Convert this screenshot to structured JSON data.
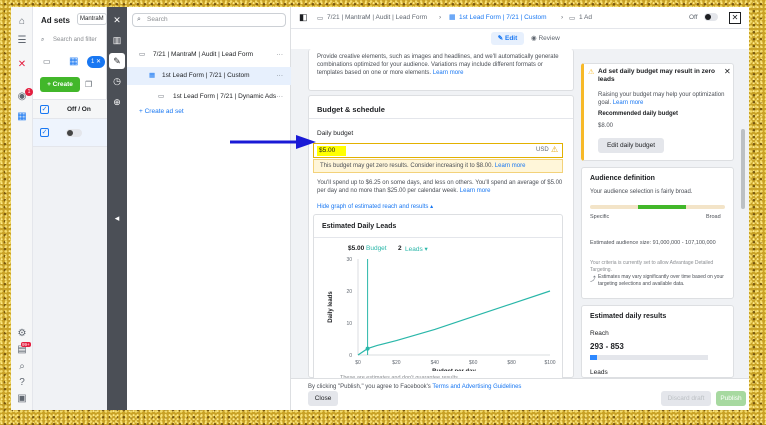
{
  "rail": {
    "notif_badge": "1",
    "alert_badge": "99+"
  },
  "adsets": {
    "title": "Ad sets",
    "tag": "MantraM",
    "search_placeholder": "Search and filter",
    "selected_count": "1",
    "create_label": "+ Create",
    "col_off_on": "Off / On"
  },
  "tree": {
    "search_placeholder": "Search",
    "items": [
      {
        "label": "7/21 | MantraM | Audit | Lead Form"
      },
      {
        "label": "1st Lead Form | 7/21 | Custom"
      },
      {
        "label": "1st Lead Form | 7/21 | Dynamic Ads"
      }
    ],
    "create_ad_set": "+ Create ad set"
  },
  "topbar": {
    "crumbs": [
      "7/21 | MantraM | Audit | Lead Form",
      "1st Lead Form | 7/21 | Custom",
      "1 Ad"
    ],
    "off_label": "Off",
    "edit_label": "Edit",
    "review_label": "Review"
  },
  "creative": {
    "text": "Provide creative elements, such as images and headlines, and we'll automatically generate combinations optimized for your audience. Variations may include different formats or templates based on one or more elements.",
    "learn_more": "Learn more"
  },
  "budget": {
    "section_title": "Budget & schedule",
    "daily_label": "Daily budget",
    "value": "$5.00",
    "currency": "USD",
    "warning": "This budget may get zero results. Consider increasing it to $8.00.",
    "warning_link": "Learn more",
    "spend_note": "You'll spend up to $6.25 on some days, and less on others. You'll spend an average of $5.00 per day and no more than $25.00 per calendar week.",
    "spend_link": "Learn more",
    "hide_graph": "Hide graph of estimated reach and results"
  },
  "chart_card": {
    "title": "Estimated Daily Leads",
    "budget_value": "$5.00",
    "budget_word": "Budget",
    "leads_value": "2",
    "leads_word": "Leads",
    "footnote": "These are estimates and don't guarantee results."
  },
  "chart_data": {
    "type": "line",
    "title": "",
    "xlabel": "Budget per day",
    "ylabel": "Daily leads",
    "x_ticks": [
      "$0",
      "$20",
      "$40",
      "$60",
      "$80",
      "$100"
    ],
    "y_ticks": [
      "0",
      "10",
      "20",
      "30"
    ],
    "xlim": [
      0,
      100
    ],
    "ylim": [
      0,
      30
    ],
    "series": [
      {
        "x": [
          0,
          5,
          10,
          20,
          40,
          60,
          80,
          100
        ],
        "y": [
          0,
          2,
          3,
          4.5,
          8,
          12,
          16,
          20
        ]
      }
    ],
    "marker": {
      "x": 5,
      "y": 2
    },
    "vline_x": 5,
    "line_color": "#2ab7a9"
  },
  "alert": {
    "title": "Ad set daily budget may result in zero leads",
    "body": "Raising your budget may help your optimization goal.",
    "body_link": "Learn more",
    "rec_label": "Recommended daily budget",
    "rec_value": "$8.00",
    "button": "Edit daily budget"
  },
  "audience": {
    "title": "Audience definition",
    "status": "Your audience selection is fairly broad.",
    "specific": "Specific",
    "broad": "Broad",
    "size": "Estimated audience size: 91,000,000 - 107,100,000",
    "criteria": "Your criteria is currently set to allow Advantage Detailed Targeting.",
    "estimate_note": "Estimates may vary significantly over time based on your targeting selections and available data."
  },
  "results": {
    "title": "Estimated daily results",
    "reach_label": "Reach",
    "reach_value": "293 - 853",
    "leads_label": "Leads"
  },
  "bottom": {
    "agree_prefix": "By clicking \"Publish,\" you agree to Facebook's",
    "agree_link": "Terms and Advertising Guidelines",
    "close": "Close",
    "discard": "Discard draft",
    "publish": "Publish"
  },
  "colors": {
    "accent": "#1877f2",
    "create_green": "#42b72a",
    "highlight_yellow": "#ffff00",
    "arrow_blue": "#1a1ad6",
    "teal": "#2ab7a9"
  }
}
